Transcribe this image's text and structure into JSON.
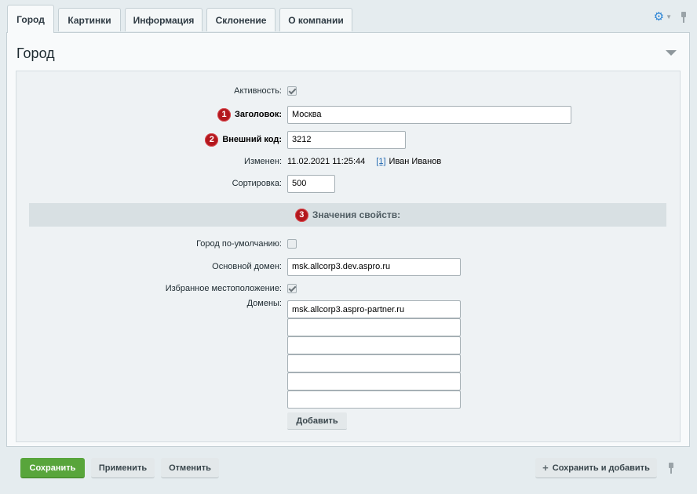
{
  "tabs": [
    {
      "label": "Город",
      "active": true
    },
    {
      "label": "Картинки",
      "active": false
    },
    {
      "label": "Информация",
      "active": false
    },
    {
      "label": "Склонение",
      "active": false
    },
    {
      "label": "О компании",
      "active": false
    }
  ],
  "section": {
    "title": "Город"
  },
  "fields": {
    "active": {
      "label": "Активность:",
      "checked": true
    },
    "title": {
      "badge": "1",
      "label": "Заголовок:",
      "value": "Москва"
    },
    "external_code": {
      "badge": "2",
      "label": "Внешний код:",
      "value": "3212"
    },
    "modified": {
      "label": "Изменен:",
      "date": "11.02.2021 11:25:44",
      "user_id": "[1]",
      "user_name": "Иван Иванов"
    },
    "sort": {
      "label": "Сортировка:",
      "value": "500"
    }
  },
  "props": {
    "badge": "3",
    "header": "Значения свойств:",
    "default_city": {
      "label": "Город по-умолчанию:",
      "checked": false
    },
    "main_domain": {
      "label": "Основной домен:",
      "value": "msk.allcorp3.dev.aspro.ru"
    },
    "favorite_location": {
      "label": "Избранное местоположение:",
      "checked": true
    },
    "domains": {
      "label": "Домены:",
      "values": [
        "msk.allcorp3.aspro-partner.ru",
        "",
        "",
        "",
        "",
        ""
      ],
      "add_label": "Добавить"
    }
  },
  "footer": {
    "save_label": "Сохранить",
    "apply_label": "Применить",
    "cancel_label": "Отменить",
    "save_add_label": "Сохранить и добавить"
  },
  "colors": {
    "save_button": "#58a53b",
    "badge": "#b3171d",
    "gear": "#2f86d6"
  },
  "icons": [
    "gear-icon",
    "chevron-down-icon",
    "pin-icon",
    "collapse-icon",
    "plus-icon"
  ]
}
